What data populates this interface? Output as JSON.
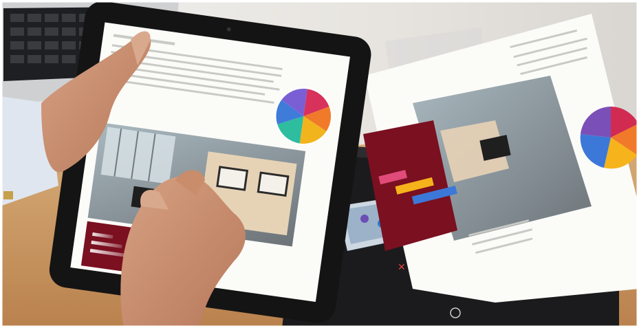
{
  "scene": {
    "description_free": true
  },
  "colors": {
    "wall": "#e8e8e6",
    "desk": "#c99a63",
    "tablet_bezel": "#141414",
    "scanner_body": "#1b1b1d",
    "paper": "#fbfbf8",
    "maroon": "#7a1020",
    "skin": "#c98d6b",
    "cuff": "#dfe6ef"
  },
  "pie_slices": [
    "#7a5fd4",
    "#d8315b",
    "#f07a2a",
    "#f2b41d",
    "#2fbda0",
    "#3f7bd8"
  ],
  "pie_slices_paper": [
    "#d12b52",
    "#f07a2a",
    "#f6b31b",
    "#3c78d8",
    "#7b4fb8"
  ],
  "scanner_icons": [
    "close-icon",
    "shortcut-icon",
    "power-icon"
  ]
}
